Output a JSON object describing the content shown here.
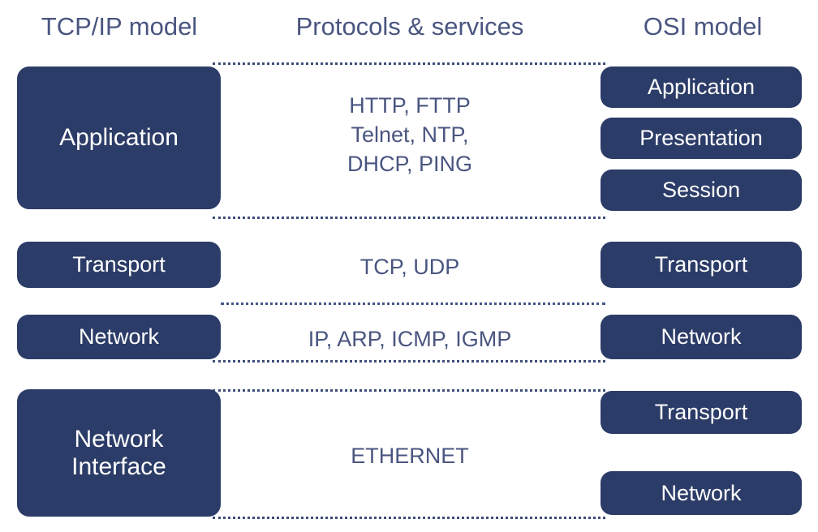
{
  "headers": [
    {
      "label": "TCP/IP model"
    },
    {
      "label": "Protocols & services"
    },
    {
      "label": "OSI model"
    }
  ],
  "colors": {
    "box_fill": "#2c3c68",
    "box_text": "#ffffff",
    "label_text": "#4a5580",
    "divider": "#3d4d79",
    "background": "#ffffff"
  },
  "tcpip_layers": [
    {
      "label": "Application"
    },
    {
      "label": "Transport"
    },
    {
      "label": "Network"
    },
    {
      "label_line1": "Network",
      "label_line2": "Interface"
    }
  ],
  "protocols": [
    {
      "text": "HTTP, FTTP\nTelnet, NTP,\nDHCP, PING"
    },
    {
      "text": "TCP, UDP"
    },
    {
      "text": "IP, ARP, ICMP, IGMP"
    },
    {
      "text": "ETHERNET"
    }
  ],
  "osi_layers": [
    {
      "label": "Application"
    },
    {
      "label": "Presentation"
    },
    {
      "label": "Session"
    },
    {
      "label": "Transport"
    },
    {
      "label": "Network"
    },
    {
      "label": "Transport"
    },
    {
      "label": "Network"
    }
  ]
}
